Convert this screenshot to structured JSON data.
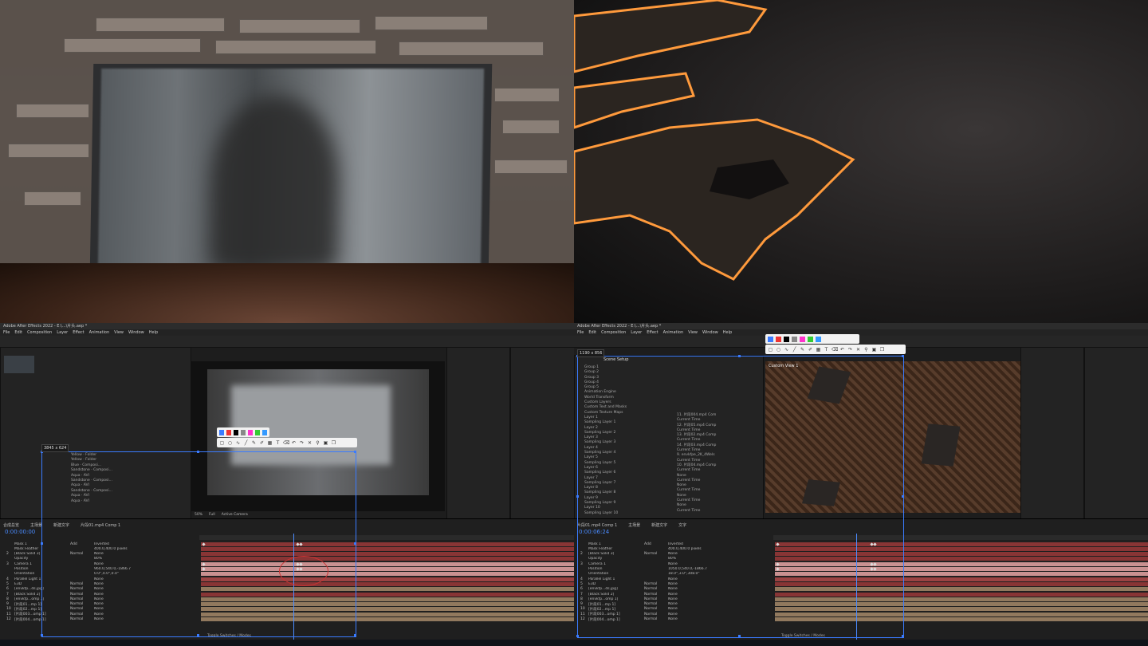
{
  "q3": {
    "title": "Adobe After Effects 2022 - E:\\...\\片头.aep *",
    "menu": [
      "File",
      "Edit",
      "Composition",
      "Layer",
      "Effect",
      "Animation",
      "View",
      "Window",
      "Help"
    ],
    "size_label": "3845 x 624",
    "timecode": "0:00:00:00",
    "comp_tabs": [
      "合成总览",
      "主场景",
      "新建文字",
      "片段01.mp4 Comp 1"
    ],
    "viewer_label": "Active Camera",
    "viewer_zoom": "50%",
    "viewer_quality": "Full",
    "layers": [
      {
        "idx": "",
        "name": "Mask 1",
        "mode": "Add",
        "extra": "Inverted"
      },
      {
        "idx": "",
        "name": "Mask Feather",
        "mode": "",
        "extra": "400.0,400.0 pixels"
      },
      {
        "idx": "2",
        "name": "[Black Solid 3]",
        "mode": "Normal",
        "extra": "None"
      },
      {
        "idx": "",
        "name": "Opacity",
        "mode": "",
        "extra": "80%"
      },
      {
        "idx": "3",
        "name": "Camera 1",
        "mode": "",
        "extra": "None"
      },
      {
        "idx": "",
        "name": "Position",
        "mode": "",
        "extra": "960.0,540.0,-1866.7"
      },
      {
        "idx": "",
        "name": "Orientation",
        "mode": "",
        "extra": "0.0°,0.0°,0.0°"
      },
      {
        "idx": "4",
        "name": "Parallel Light 1",
        "mode": "",
        "extra": "None"
      },
      {
        "idx": "5",
        "name": "E3D",
        "mode": "Normal",
        "extra": "None"
      },
      {
        "idx": "6",
        "name": "[envkfp...ds.jpg]",
        "mode": "Normal",
        "extra": "None"
      },
      {
        "idx": "7",
        "name": "[Black Solid 2]",
        "mode": "Normal",
        "extra": "None"
      },
      {
        "idx": "8",
        "name": "[envkfp...omp 1]",
        "mode": "Normal",
        "extra": "None"
      },
      {
        "idx": "9",
        "name": "[片段01...mp 1]",
        "mode": "Normal",
        "extra": "None"
      },
      {
        "idx": "10",
        "name": "[片段02...mp 1]",
        "mode": "Normal",
        "extra": "None"
      },
      {
        "idx": "11",
        "name": "[片段003...omp 1]",
        "mode": "Normal",
        "extra": "None"
      },
      {
        "idx": "12",
        "name": "[片段004...omp 1]",
        "mode": "Normal",
        "extra": "None"
      }
    ],
    "project_items": [
      {
        "name": "Yellow",
        "type": "Folder"
      },
      {
        "name": "Yellow",
        "type": "Folder"
      },
      {
        "name": "Blue",
        "type": "Composi..."
      },
      {
        "name": "Sandstone",
        "type": "Composi..."
      },
      {
        "name": "Aqua",
        "type": "AVI"
      },
      {
        "name": "Sandstone",
        "type": "Composi..."
      },
      {
        "name": "Aqua",
        "type": "AVI"
      },
      {
        "name": "Sandstone",
        "type": "Composi..."
      },
      {
        "name": "Aqua",
        "type": "AVI"
      },
      {
        "name": "Aqua",
        "type": "AVI"
      }
    ],
    "bottom_label": "Toggle Switches / Modes"
  },
  "q4": {
    "title": "Adobe After Effects 2022 - E:\\...\\片头.aep *",
    "menu": [
      "File",
      "Edit",
      "Composition",
      "Layer",
      "Effect",
      "Animation",
      "View",
      "Window",
      "Help"
    ],
    "size_label": "1190 x 856",
    "timecode": "0:00:06:24",
    "panel_title": "Scene Setup",
    "scene_items": [
      "Group 1",
      "Group 2",
      "Group 3",
      "Group 4",
      "Group 5",
      "Animation Engine",
      "World Transform",
      "Custom Layers",
      "Custom Text and Masks",
      "Custom Texture Maps",
      "Layer 1",
      "Sampling Layer 1",
      "Layer 2",
      "Sampling Layer 2",
      "Layer 3",
      "Sampling Layer 3",
      "Layer 4",
      "Sampling Layer 4",
      "Layer 5",
      "Sampling Layer 5",
      "Layer 6",
      "Sampling Layer 6",
      "Layer 7",
      "Sampling Layer 7",
      "Layer 8",
      "Sampling Layer 8",
      "Layer 9",
      "Sampling Layer 9",
      "Layer 10",
      "Sampling Layer 10"
    ],
    "layer_values": [
      "11. 片段004.mp4 Com",
      "Current Time",
      "12. 片段05.mp4 Comp",
      "Current Time",
      "13. 片段02.mp4 Comp",
      "Current Time",
      "14. 片段03.mp4 Comp",
      "Current Time",
      "9. envkfpe_2K_4Wels",
      "Current Time",
      "10. 片段04.mp4 Comp",
      "Current Time",
      "None",
      "Current Time",
      "None",
      "Current Time",
      "None",
      "Current Time",
      "None",
      "Current Time"
    ],
    "viewer_label": "Custom View 1",
    "comp_tabs": [
      "片段01.mp4 Comp 1",
      "主场景",
      "新建文字",
      "文字"
    ],
    "layers": [
      {
        "idx": "",
        "name": "Mask 1",
        "mode": "Add",
        "extra": "Inverted"
      },
      {
        "idx": "",
        "name": "Mask Feather",
        "mode": "",
        "extra": "400.0,400.0 pixels"
      },
      {
        "idx": "2",
        "name": "[Black Solid 3]",
        "mode": "Normal",
        "extra": "None"
      },
      {
        "idx": "",
        "name": "Opacity",
        "mode": "",
        "extra": "80%"
      },
      {
        "idx": "3",
        "name": "Camera 1",
        "mode": "",
        "extra": "None"
      },
      {
        "idx": "",
        "name": "Position",
        "mode": "",
        "extra": "1050.0,540.0,-1866.7"
      },
      {
        "idx": "",
        "name": "Orientation",
        "mode": "",
        "extra": "18.0°,3.0°,308.0°"
      },
      {
        "idx": "4",
        "name": "Parallel Light 1",
        "mode": "",
        "extra": "None"
      },
      {
        "idx": "5",
        "name": "E3D",
        "mode": "Normal",
        "extra": "None"
      },
      {
        "idx": "6",
        "name": "[envkfp...ds.jpg]",
        "mode": "Normal",
        "extra": "None"
      },
      {
        "idx": "7",
        "name": "[Black Solid 2]",
        "mode": "Normal",
        "extra": "None"
      },
      {
        "idx": "8",
        "name": "[envkfp...omp 1]",
        "mode": "Normal",
        "extra": "None"
      },
      {
        "idx": "9",
        "name": "[片段01...mp 1]",
        "mode": "Normal",
        "extra": "None"
      },
      {
        "idx": "10",
        "name": "[片段02...mp 1]",
        "mode": "Normal",
        "extra": "None"
      },
      {
        "idx": "11",
        "name": "[片段003...omp 1]",
        "mode": "Normal",
        "extra": "None"
      },
      {
        "idx": "12",
        "name": "[片段004...omp 1]",
        "mode": "Normal",
        "extra": "None"
      }
    ],
    "bottom_label": "Toggle Switches / Modes"
  },
  "colors": {
    "accent": "#3a7bff",
    "burn": "#ff9a3c",
    "camera_bar": "#e8a6a6",
    "red_bar": "#9b3a3a",
    "tan_bar": "#a68a6a"
  }
}
